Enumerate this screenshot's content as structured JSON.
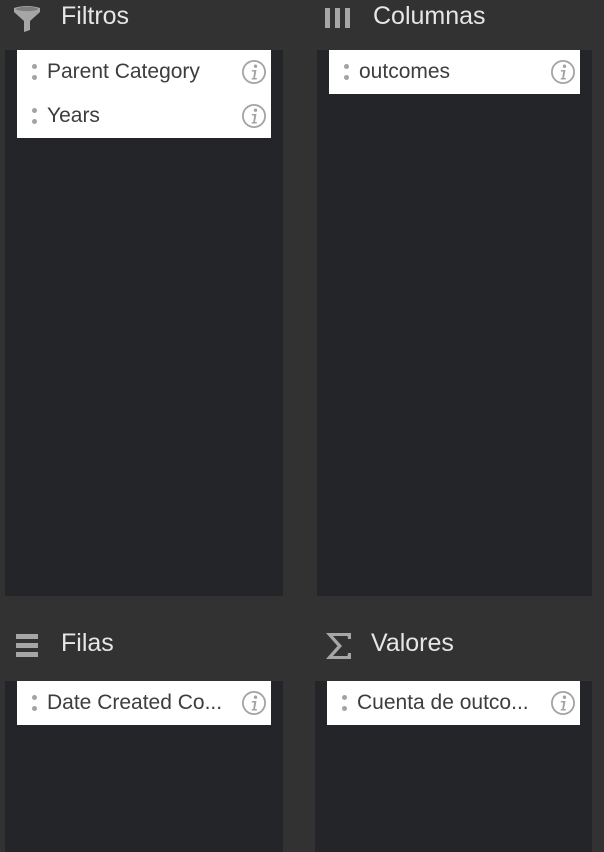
{
  "areas": {
    "filters": {
      "title": "Filtros",
      "icon": "filter-icon",
      "fields": [
        {
          "label": "Parent Category"
        },
        {
          "label": "Years"
        }
      ]
    },
    "columns": {
      "title": "Columnas",
      "icon": "columns-icon",
      "fields": [
        {
          "label": "outcomes"
        }
      ]
    },
    "rows": {
      "title": "Filas",
      "icon": "rows-icon",
      "fields": [
        {
          "label": "Date Created Co..."
        }
      ]
    },
    "values": {
      "title": "Valores",
      "icon": "sigma-icon",
      "fields": [
        {
          "label": "Cuenta de outco..."
        }
      ]
    }
  },
  "colors": {
    "background": "#323232",
    "drop_zone": "#242528",
    "header_text": "#e6e6e6",
    "pill_background": "#ffffff",
    "pill_text": "#3d3d3d",
    "icon_gray": "#a3a3a3"
  }
}
